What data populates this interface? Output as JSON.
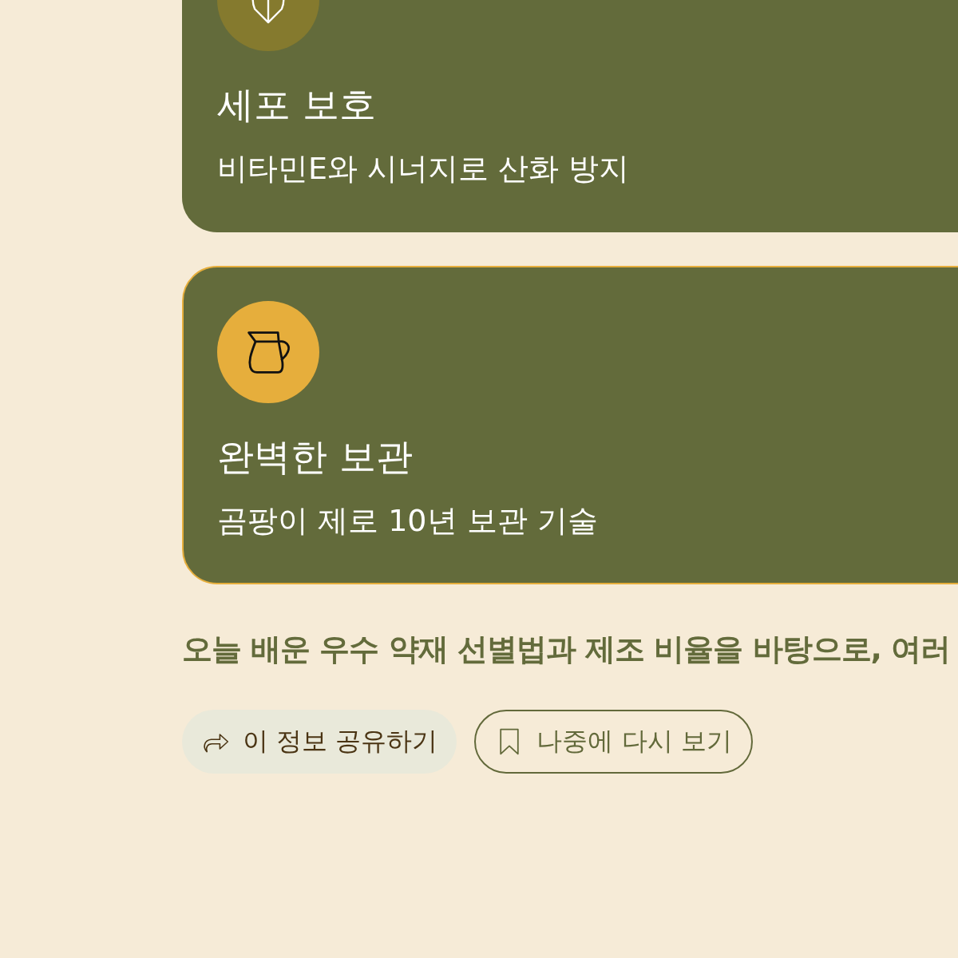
{
  "cards": [
    {
      "kind": "leaf",
      "highlighted": false,
      "title": "세포 보호",
      "description": "비타민E와 시너지로 산화 방지"
    },
    {
      "kind": "pitcher",
      "highlighted": true,
      "title": "완벽한 보관",
      "description": "곰팡이 제로 10년 보관 기술"
    }
  ],
  "summary": "오늘 배운 우수 약재 선별법과 제조 비율을 바탕으로, 여러",
  "actions": [
    {
      "kind": "share",
      "label": "이 정보 공유하기"
    },
    {
      "kind": "bookmark",
      "label": "나중에 다시 보기"
    }
  ]
}
